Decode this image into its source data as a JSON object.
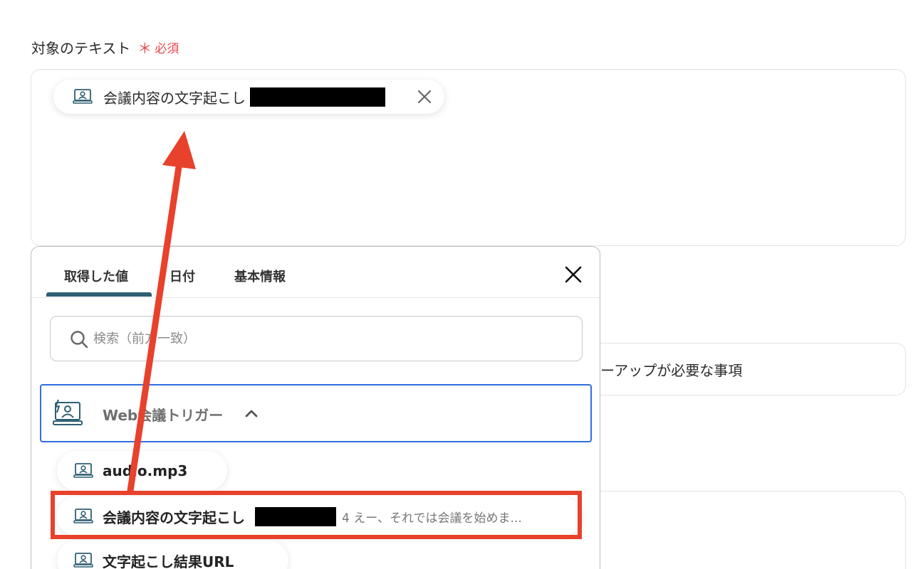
{
  "form": {
    "field_label": "対象のテキスト",
    "required_star": "＊",
    "required_label": "必須",
    "selected_chip": {
      "label": "会議内容の文字起こし",
      "icon": "meeting-screen-icon"
    },
    "background_row_text": "ーアップが必要な事項"
  },
  "panel": {
    "tabs": [
      {
        "label": "取得した値",
        "active": true
      },
      {
        "label": "日付",
        "active": false
      },
      {
        "label": "基本情報",
        "active": false
      }
    ],
    "search": {
      "placeholder": "検索（前方一致）",
      "value": ""
    },
    "group": {
      "title": "Web会議トリガー",
      "expanded": true,
      "icon": "meeting-trigger-icon"
    },
    "items": [
      {
        "label": "audio.mp3",
        "value": ""
      },
      {
        "label": "会議内容の文字起こし",
        "value": "4 えー、それでは会議を始めま..."
      },
      {
        "label": "文字起こし結果URL",
        "value": ""
      }
    ]
  },
  "colors": {
    "required": "#e5484d",
    "tab_underline": "#2f5f73",
    "group_border": "#2f6fe0",
    "annotation": "#e8412c",
    "icon": "#2f5f73"
  }
}
